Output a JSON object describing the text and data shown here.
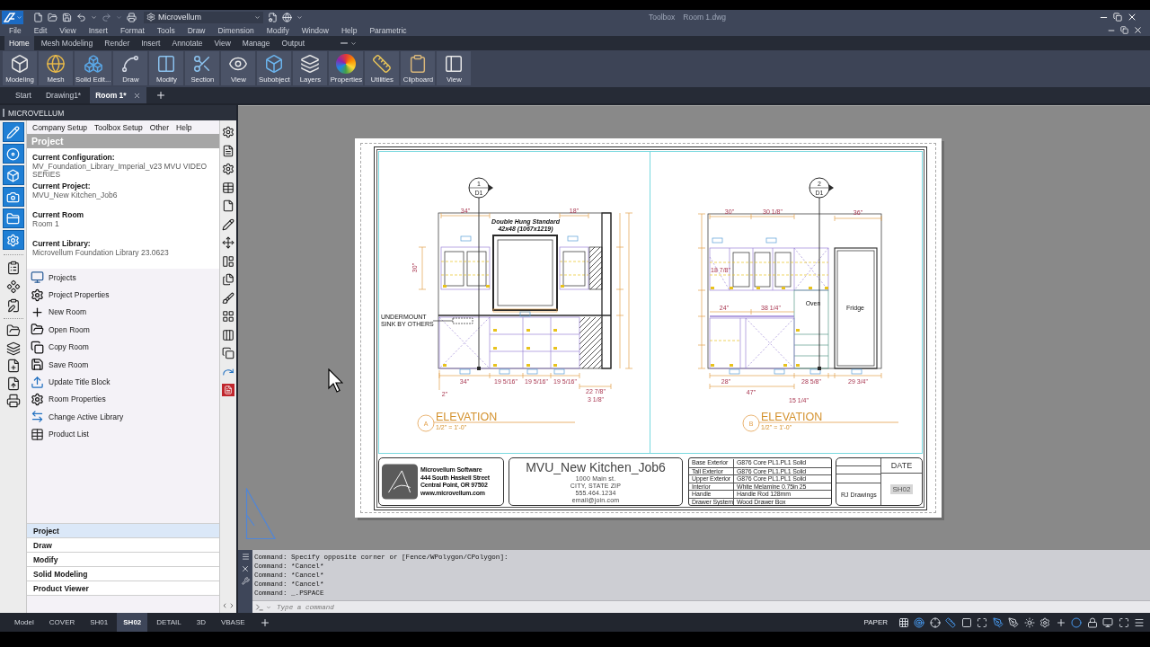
{
  "title_bar": {
    "workspace": "Microvellum",
    "app_name": "Toolbox",
    "document": "Room 1.dwg"
  },
  "menu_bar": [
    "File",
    "Edit",
    "View",
    "Insert",
    "Format",
    "Tools",
    "Draw",
    "Dimension",
    "Modify",
    "Window",
    "Help",
    "Parametric"
  ],
  "ribbon_tabs": [
    {
      "label": "Home",
      "selected": true
    },
    {
      "label": "Mesh Modeling",
      "selected": false
    },
    {
      "label": "Render",
      "selected": false
    },
    {
      "label": "Insert",
      "selected": false
    },
    {
      "label": "Annotate",
      "selected": false
    },
    {
      "label": "View",
      "selected": false
    },
    {
      "label": "Manage",
      "selected": false
    },
    {
      "label": "Output",
      "selected": false
    }
  ],
  "ribbon_panels": [
    "Modeling",
    "Mesh",
    "Solid Edit...",
    "Draw",
    "Modify",
    "Section",
    "View",
    "Subobject",
    "Layers",
    "Properties",
    "Utilities",
    "Clipboard",
    "View"
  ],
  "file_tabs": [
    {
      "label": "Start",
      "selected": false
    },
    {
      "label": "Drawing1*",
      "selected": false
    },
    {
      "label": "Room 1*",
      "selected": true
    }
  ],
  "palette": {
    "title": "MICROVELLUM",
    "menu": [
      "Company Setup",
      "Toolbox Setup",
      "Other",
      "Help"
    ],
    "section_title": "Project",
    "info": [
      {
        "label": "Current Configuration:",
        "value": "MV_Foundation_Library_Imperial_v23 MVU VIDEO SERIES"
      },
      {
        "label": "Current Project:",
        "value": "MVU_New Kitchen_Job6"
      },
      {
        "label": "Current Room",
        "value": "Room 1"
      },
      {
        "label": "Current Library:",
        "value": "Microvellum Foundation Library 23.0623"
      }
    ],
    "actions": [
      "Projects",
      "Project Properties",
      "New Room",
      "Open Room",
      "Copy Room",
      "Save Room",
      "Update Title Block",
      "Room Properties",
      "Change Active Library",
      "Product List"
    ],
    "panels": [
      {
        "label": "Project",
        "selected": true
      },
      {
        "label": "Draw",
        "selected": false
      },
      {
        "label": "Modify",
        "selected": false
      },
      {
        "label": "Solid Modeling",
        "selected": false
      },
      {
        "label": "Product Viewer",
        "selected": false
      }
    ]
  },
  "sheet": {
    "elevations": [
      {
        "callout_number": "1",
        "callout_sheet": "D1",
        "marker": "A",
        "title": "ELEVATION",
        "scale": "1/2\" = 1'-0\"",
        "labels": [
          {
            "text": "Double Hung Standard",
            "kind": "window_tag"
          },
          {
            "text": "42x48 (1067x1219)",
            "kind": "window_tag"
          },
          {
            "text": "UNDERMOUNT",
            "kind": "note"
          },
          {
            "text": "SINK BY OTHERS",
            "kind": "note"
          },
          {
            "text": "34\"",
            "kind": "dimension"
          },
          {
            "text": "18\"",
            "kind": "dimension"
          },
          {
            "text": "30\"",
            "kind": "dimension"
          },
          {
            "text": "34\"",
            "kind": "dimension"
          },
          {
            "text": "19 5/16\"",
            "kind": "dimension"
          },
          {
            "text": "19 5/16\"",
            "kind": "dimension"
          },
          {
            "text": "19 5/16\"",
            "kind": "dimension"
          },
          {
            "text": "22 7/8\"",
            "kind": "dimension"
          },
          {
            "text": "3 1/8\"",
            "kind": "dimension"
          },
          {
            "text": "2\"",
            "kind": "dimension"
          }
        ]
      },
      {
        "callout_number": "2",
        "callout_sheet": "D1",
        "marker": "B",
        "title": "ELEVATION",
        "scale": "1/2\" = 1'-0\"",
        "labels": [
          {
            "text": "30\"",
            "kind": "dimension"
          },
          {
            "text": "30 1/8\"",
            "kind": "dimension"
          },
          {
            "text": "36\"",
            "kind": "dimension"
          },
          {
            "text": "18 7/8\"",
            "kind": "dimension"
          },
          {
            "text": "24\"",
            "kind": "dimension"
          },
          {
            "text": "38 1/4\"",
            "kind": "dimension"
          },
          {
            "text": "Oven",
            "kind": "note"
          },
          {
            "text": "Fridge",
            "kind": "note"
          },
          {
            "text": "28\"",
            "kind": "dimension"
          },
          {
            "text": "47\"",
            "kind": "dimension"
          },
          {
            "text": "28 5/8\"",
            "kind": "dimension"
          },
          {
            "text": "29 3/4\"",
            "kind": "dimension"
          },
          {
            "text": "15 1/4\"",
            "kind": "dimension"
          }
        ]
      }
    ],
    "title_block": {
      "company": [
        "Microvellum Software",
        "444 South Haskell Street",
        "Central Point, OR 97502",
        "www.microvellum.com"
      ],
      "project_name": "MVU_New Kitchen_Job6",
      "project_address": [
        "1000 Main st.",
        "CITY, STATE ZIP",
        "555.464.1234",
        "email@join.com"
      ],
      "materials": [
        {
          "item": "Base Exterior",
          "value": "G876 Core PL1.PL1 Solid"
        },
        {
          "item": "Tall Exterior",
          "value": "G876 Core PL1.PL1 Solid"
        },
        {
          "item": "Upper Exterior",
          "value": "G876 Core PL1.PL1 Solid"
        },
        {
          "item": "Interior",
          "value": "White Melamine 0.75in 25"
        },
        {
          "item": "Handle",
          "value": "Handle Rod 128mm"
        },
        {
          "item": "Drawer System",
          "value": "Wood Drawer Box"
        }
      ],
      "date": "DATE",
      "sheet_number": "SH02",
      "drawn_by": "RJ Drawings"
    }
  },
  "command_line": {
    "history": [
      "Command: Specify opposite corner or [Fence/WPolygon/CPolygon]:",
      "Command: *Cancel*",
      "Command: *Cancel*",
      "Command: *Cancel*",
      "Command: _.PSPACE"
    ],
    "placeholder": "Type a command"
  },
  "layout_tabs": [
    {
      "label": "Model",
      "selected": false
    },
    {
      "label": "COVER",
      "selected": false
    },
    {
      "label": "SH01",
      "selected": false
    },
    {
      "label": "SH02",
      "selected": true
    },
    {
      "label": "DETAIL",
      "selected": false
    },
    {
      "label": "3D",
      "selected": false
    },
    {
      "label": "VBASE",
      "selected": false
    }
  ],
  "status_bar": {
    "space": "PAPER"
  }
}
